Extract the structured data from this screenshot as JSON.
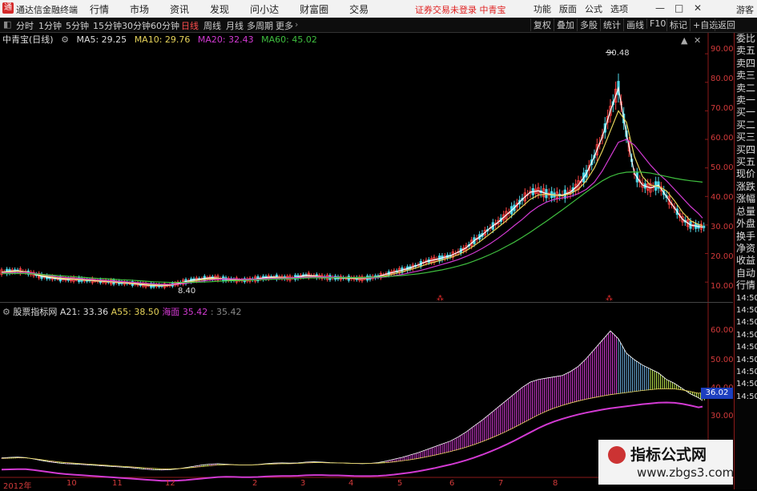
{
  "titlebar": {
    "app_name": "通达信金融终端",
    "menu": [
      "行情",
      "市场",
      "资讯",
      "发现",
      "问小达",
      "财富圈",
      "交易"
    ],
    "notice": "证券交易未登录  中青宝",
    "right_menu": [
      "功能",
      "版面",
      "公式",
      "选项"
    ],
    "guest": "游客",
    "minimize": "—",
    "maximize": "□",
    "close": "✕"
  },
  "toolbar": {
    "periods": [
      "分时",
      "1分钟",
      "5分钟",
      "15分钟",
      "30分钟",
      "60分钟",
      "日线",
      "周线",
      "月线",
      "多周期",
      "更多"
    ],
    "active": "日线",
    "right": [
      "复权",
      "叠加",
      "多股",
      "统计",
      "画线",
      "F10",
      "标记",
      "+自选",
      "返回"
    ]
  },
  "main_chart": {
    "stock": "中青宝(日线)",
    "ma5": "MA5: 29.25",
    "ma10": "MA10: 29.76",
    "ma20": "MA20: 32.43",
    "ma60": "MA60: 45.02",
    "high_label": "90.48",
    "low_label": "8.40",
    "y_ticks": [
      "90.00",
      "80.00",
      "70.00",
      "60.00",
      "50.00",
      "40.00",
      "30.00",
      "20.00",
      "10.00"
    ],
    "colors": {
      "ma5": "#ffffff",
      "ma10": "#e6d35a",
      "ma20": "#d23ad2",
      "ma60": "#3fbf3f"
    }
  },
  "indicator": {
    "name": "股票指标网",
    "a21": "A21: 33.36",
    "a55": "A55: 38.50",
    "sea": "海面",
    "v1": "35.42",
    "v2": "35.42",
    "y_ticks": [
      "60.00",
      "50.00",
      "40.00",
      "30.00"
    ],
    "badge": "36.02"
  },
  "right_panel": [
    "委比",
    "卖五",
    "卖四",
    "卖三",
    "卖二",
    "卖一",
    "买一",
    "买二",
    "买三",
    "买四",
    "买五",
    "现价",
    "涨跌",
    "涨幅",
    "总量",
    "外盘",
    "换手",
    "净资",
    "收益",
    "自动",
    "行情",
    "14:50",
    "14:50",
    "14:50",
    "14:50",
    "14:50",
    "14:50",
    "14:50",
    "14:50",
    "14:50"
  ],
  "x_labels": [
    "2012年",
    "10",
    "11",
    "12",
    "2",
    "3",
    "4",
    "5",
    "6",
    "7",
    "8"
  ],
  "watermark": {
    "title": "指标公式网",
    "url": "www.zbgs3.com"
  },
  "chart_data": {
    "type": "line",
    "x": [
      0,
      10,
      20,
      30,
      40,
      50,
      60,
      70,
      80,
      90,
      100,
      110,
      120,
      130,
      140,
      150,
      160,
      170,
      180,
      190,
      200,
      210,
      220,
      230,
      240,
      250,
      260,
      270,
      280,
      290,
      300,
      310,
      320,
      330,
      340,
      350,
      360,
      370,
      380,
      390,
      400,
      410,
      420,
      430,
      440,
      450,
      460,
      470,
      480,
      490,
      500,
      510,
      520,
      530,
      540,
      550,
      560,
      570,
      580,
      590,
      600,
      610,
      620,
      630,
      640,
      650,
      660,
      670,
      680,
      690,
      700,
      710,
      720,
      730,
      740,
      750,
      760,
      770,
      780,
      790,
      800,
      810,
      820,
      830,
      840,
      850,
      860,
      870,
      875
    ],
    "series": [
      {
        "name": "MA5",
        "values": [
          13.5,
          13.8,
          14.0,
          13.6,
          12.8,
          12.0,
          11.6,
          11.2,
          11.0,
          11.0,
          10.8,
          10.6,
          10.4,
          10.2,
          10.0,
          9.8,
          9.6,
          9.3,
          9.0,
          8.8,
          8.7,
          8.9,
          9.5,
          10.2,
          10.8,
          11.2,
          11.5,
          11.4,
          11.0,
          10.8,
          10.6,
          10.8,
          11.2,
          11.6,
          11.8,
          11.6,
          11.4,
          11.8,
          12.4,
          12.2,
          11.8,
          11.6,
          11.5,
          11.4,
          11.3,
          11.2,
          11.5,
          12.0,
          12.8,
          13.5,
          14.2,
          15.0,
          16.0,
          17.2,
          17.8,
          18.5,
          19.2,
          20.5,
          22.0,
          24.5,
          26.5,
          29.0,
          31.0,
          33.5,
          36.0,
          39.0,
          41.5,
          42.0,
          41.0,
          40.5,
          40.5,
          41.5,
          44.0,
          48.0,
          54.0,
          61.0,
          70.0,
          78.0,
          62.0,
          48.0,
          44.0,
          43.0,
          44.0,
          40.0,
          36.0,
          32.0,
          30.0,
          29.5,
          29.25
        ]
      },
      {
        "name": "MA10",
        "values": [
          13.4,
          13.6,
          13.8,
          13.6,
          13.0,
          12.4,
          11.9,
          11.5,
          11.2,
          11.1,
          10.9,
          10.7,
          10.5,
          10.3,
          10.1,
          9.9,
          9.7,
          9.5,
          9.2,
          9.0,
          8.9,
          9.0,
          9.3,
          9.8,
          10.3,
          10.8,
          11.1,
          11.3,
          11.1,
          10.9,
          10.8,
          10.8,
          11.0,
          11.3,
          11.5,
          11.6,
          11.5,
          11.6,
          11.9,
          12.0,
          11.9,
          11.7,
          11.6,
          11.5,
          11.4,
          11.3,
          11.4,
          11.7,
          12.2,
          12.9,
          13.6,
          14.4,
          15.2,
          16.2,
          17.0,
          17.8,
          18.6,
          19.6,
          21.0,
          22.8,
          24.8,
          27.0,
          29.2,
          31.5,
          34.0,
          36.5,
          39.0,
          40.5,
          40.8,
          40.5,
          40.3,
          41.0,
          42.5,
          45.5,
          50.0,
          56.0,
          63.0,
          70.0,
          66.0,
          54.0,
          47.0,
          44.0,
          43.5,
          42.0,
          38.5,
          34.5,
          31.5,
          30.2,
          29.76
        ]
      },
      {
        "name": "MA20",
        "values": [
          13.2,
          13.3,
          13.4,
          13.4,
          13.1,
          12.7,
          12.3,
          11.9,
          11.6,
          11.4,
          11.2,
          11.0,
          10.8,
          10.6,
          10.4,
          10.2,
          10.0,
          9.8,
          9.6,
          9.4,
          9.2,
          9.2,
          9.3,
          9.6,
          9.9,
          10.3,
          10.7,
          11.0,
          11.1,
          11.1,
          11.0,
          11.0,
          11.0,
          11.2,
          11.3,
          11.4,
          11.5,
          11.6,
          11.7,
          11.8,
          11.8,
          11.8,
          11.7,
          11.6,
          11.6,
          11.5,
          11.5,
          11.6,
          11.8,
          12.2,
          12.7,
          13.3,
          13.9,
          14.6,
          15.4,
          16.2,
          17.0,
          17.9,
          19.0,
          20.3,
          21.8,
          23.5,
          25.4,
          27.5,
          29.8,
          32.0,
          34.5,
          36.5,
          38.0,
          39.0,
          39.5,
          40.0,
          41.0,
          42.5,
          45.0,
          49.0,
          54.0,
          59.0,
          60.0,
          58.0,
          54.5,
          51.0,
          48.0,
          45.5,
          42.5,
          39.5,
          36.5,
          34.0,
          32.43
        ]
      },
      {
        "name": "MA60",
        "values": [
          13.0,
          13.0,
          13.0,
          13.0,
          12.9,
          12.7,
          12.5,
          12.3,
          12.1,
          11.9,
          11.7,
          11.5,
          11.3,
          11.2,
          11.0,
          10.8,
          10.7,
          10.5,
          10.3,
          10.1,
          10.0,
          9.9,
          9.9,
          9.9,
          9.9,
          10.0,
          10.1,
          10.3,
          10.4,
          10.5,
          10.6,
          10.7,
          10.8,
          10.9,
          11.0,
          11.1,
          11.2,
          11.3,
          11.4,
          11.5,
          11.5,
          11.5,
          11.6,
          11.6,
          11.6,
          11.6,
          11.7,
          11.8,
          11.9,
          12.1,
          12.3,
          12.6,
          12.9,
          13.3,
          13.8,
          14.3,
          14.9,
          15.6,
          16.4,
          17.4,
          18.5,
          19.7,
          21.0,
          22.5,
          24.0,
          25.7,
          27.5,
          29.4,
          31.3,
          33.3,
          35.3,
          37.4,
          39.5,
          41.6,
          43.6,
          45.5,
          47.0,
          48.0,
          48.5,
          48.6,
          48.5,
          48.2,
          47.6,
          47.0,
          46.4,
          45.9,
          45.5,
          45.2,
          45.02
        ]
      }
    ],
    "ylim": [
      5,
      92
    ]
  },
  "indicator_data": {
    "type": "area",
    "x": [
      0,
      10,
      20,
      30,
      40,
      50,
      60,
      70,
      80,
      90,
      100,
      110,
      120,
      130,
      140,
      150,
      160,
      170,
      180,
      190,
      200,
      210,
      220,
      230,
      240,
      250,
      260,
      270,
      280,
      290,
      300,
      310,
      320,
      330,
      340,
      350,
      360,
      370,
      380,
      390,
      400,
      410,
      420,
      430,
      440,
      450,
      460,
      470,
      480,
      490,
      500,
      510,
      520,
      530,
      540,
      550,
      560,
      570,
      580,
      590,
      600,
      610,
      620,
      630,
      640,
      650,
      660,
      670,
      680,
      690,
      700,
      710,
      720,
      730,
      740,
      750,
      760,
      770,
      780,
      790,
      800,
      810,
      820,
      830,
      840,
      850,
      860,
      870,
      875
    ],
    "upper": [
      13.6,
      13.8,
      13.9,
      13.7,
      13.2,
      12.6,
      12.1,
      11.7,
      11.4,
      11.3,
      11.1,
      10.9,
      10.7,
      10.5,
      10.3,
      10.1,
      9.9,
      9.6,
      9.3,
      9.1,
      9.0,
      9.1,
      9.4,
      9.9,
      10.4,
      10.9,
      11.2,
      11.4,
      11.2,
      11.0,
      10.9,
      10.9,
      11.1,
      11.4,
      11.6,
      11.7,
      11.6,
      11.7,
      12.0,
      12.1,
      12.0,
      11.8,
      11.7,
      11.6,
      11.5,
      11.4,
      11.5,
      11.8,
      12.4,
      13.1,
      13.8,
      14.7,
      15.6,
      16.7,
      17.8,
      18.9,
      20.0,
      21.6,
      23.5,
      25.8,
      28.0,
      30.5,
      33.0,
      35.5,
      38.0,
      40.5,
      42.5,
      43.5,
      44.0,
      44.5,
      45.0,
      46.5,
      48.5,
      51.5,
      55.0,
      58.5,
      62.0,
      59.0,
      53.5,
      51.0,
      49.0,
      47.5,
      46.0,
      43.5,
      42.0,
      40.0,
      38.0,
      36.5,
      35.42
    ],
    "lower": [
      13.4,
      13.5,
      13.6,
      13.6,
      13.3,
      12.9,
      12.5,
      12.1,
      11.8,
      11.6,
      11.4,
      11.2,
      11.0,
      10.8,
      10.6,
      10.4,
      10.2,
      10.0,
      9.8,
      9.6,
      9.4,
      9.4,
      9.5,
      9.7,
      10.0,
      10.3,
      10.6,
      10.9,
      11.0,
      11.0,
      10.9,
      10.9,
      11.0,
      11.2,
      11.3,
      11.4,
      11.4,
      11.5,
      11.7,
      11.8,
      11.8,
      11.7,
      11.7,
      11.6,
      11.5,
      11.5,
      11.5,
      11.6,
      11.8,
      12.1,
      12.5,
      12.9,
      13.4,
      14.0,
      14.6,
      15.3,
      16.0,
      16.8,
      17.7,
      18.7,
      19.8,
      21.0,
      22.3,
      23.7,
      25.2,
      26.8,
      28.4,
      30.0,
      31.4,
      32.6,
      33.6,
      34.5,
      35.3,
      36.0,
      36.6,
      37.2,
      37.7,
      38.1,
      38.5,
      38.9,
      39.3,
      39.6,
      39.9,
      40.0,
      39.9,
      39.5,
      38.9,
      38.2,
      38.5
    ],
    "ylim": [
      8,
      66
    ]
  }
}
